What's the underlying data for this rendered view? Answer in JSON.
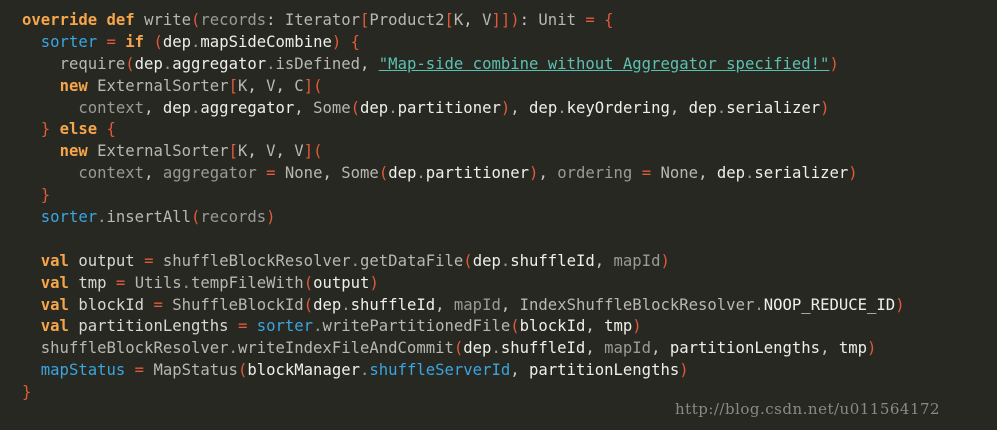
{
  "code_lines": [
    {
      "indent": "",
      "tokens": [
        {
          "k": "kw",
          "t": "override"
        },
        {
          "k": "pl",
          "t": " "
        },
        {
          "k": "kw",
          "t": "def"
        },
        {
          "k": "pl",
          "t": " "
        },
        {
          "k": "fn",
          "t": "write"
        },
        {
          "k": "br",
          "t": "("
        },
        {
          "k": "param",
          "t": "records"
        },
        {
          "k": "pl",
          "t": ": "
        },
        {
          "k": "type",
          "t": "Iterator"
        },
        {
          "k": "br",
          "t": "["
        },
        {
          "k": "type",
          "t": "Product2"
        },
        {
          "k": "br",
          "t": "["
        },
        {
          "k": "tp",
          "t": "K"
        },
        {
          "k": "pl",
          "t": ", "
        },
        {
          "k": "tp",
          "t": "V"
        },
        {
          "k": "br",
          "t": "]]"
        },
        {
          "k": "br",
          "t": ")"
        },
        {
          "k": "pl",
          "t": ": "
        },
        {
          "k": "type",
          "t": "Unit"
        },
        {
          "k": "pl",
          "t": " "
        },
        {
          "k": "op",
          "t": "="
        },
        {
          "k": "pl",
          "t": " "
        },
        {
          "k": "br",
          "t": "{"
        }
      ]
    },
    {
      "indent": "  ",
      "tokens": [
        {
          "k": "var",
          "t": "sorter"
        },
        {
          "k": "pl",
          "t": " "
        },
        {
          "k": "op",
          "t": "="
        },
        {
          "k": "pl",
          "t": " "
        },
        {
          "k": "kw",
          "t": "if"
        },
        {
          "k": "pl",
          "t": " "
        },
        {
          "k": "br",
          "t": "("
        },
        {
          "k": "id",
          "t": "dep"
        },
        {
          "k": "dot",
          "t": "."
        },
        {
          "k": "mem",
          "t": "mapSideCombine"
        },
        {
          "k": "br",
          "t": ")"
        },
        {
          "k": "pl",
          "t": " "
        },
        {
          "k": "br",
          "t": "{"
        }
      ]
    },
    {
      "indent": "    ",
      "tokens": [
        {
          "k": "fn",
          "t": "require"
        },
        {
          "k": "br",
          "t": "("
        },
        {
          "k": "id",
          "t": "dep"
        },
        {
          "k": "dot",
          "t": "."
        },
        {
          "k": "mem",
          "t": "aggregator"
        },
        {
          "k": "dot",
          "t": "."
        },
        {
          "k": "fn",
          "t": "isDefined"
        },
        {
          "k": "pl",
          "t": ", "
        },
        {
          "k": "str",
          "t": "\"Map-side combine without Aggregator specified!\""
        },
        {
          "k": "br",
          "t": ")"
        }
      ]
    },
    {
      "indent": "    ",
      "tokens": [
        {
          "k": "kw",
          "t": "new"
        },
        {
          "k": "pl",
          "t": " "
        },
        {
          "k": "type",
          "t": "ExternalSorter"
        },
        {
          "k": "br",
          "t": "["
        },
        {
          "k": "tp",
          "t": "K"
        },
        {
          "k": "pl",
          "t": ", "
        },
        {
          "k": "tp",
          "t": "V"
        },
        {
          "k": "pl",
          "t": ", "
        },
        {
          "k": "tp",
          "t": "C"
        },
        {
          "k": "br",
          "t": "]("
        }
      ]
    },
    {
      "indent": "      ",
      "tokens": [
        {
          "k": "param",
          "t": "context"
        },
        {
          "k": "pl",
          "t": ", "
        },
        {
          "k": "id",
          "t": "dep"
        },
        {
          "k": "dot",
          "t": "."
        },
        {
          "k": "mem",
          "t": "aggregator"
        },
        {
          "k": "pl",
          "t": ", "
        },
        {
          "k": "type",
          "t": "Some"
        },
        {
          "k": "br",
          "t": "("
        },
        {
          "k": "id",
          "t": "dep"
        },
        {
          "k": "dot",
          "t": "."
        },
        {
          "k": "mem",
          "t": "partitioner"
        },
        {
          "k": "br",
          "t": ")"
        },
        {
          "k": "pl",
          "t": ", "
        },
        {
          "k": "id",
          "t": "dep"
        },
        {
          "k": "dot",
          "t": "."
        },
        {
          "k": "mem",
          "t": "keyOrdering"
        },
        {
          "k": "pl",
          "t": ", "
        },
        {
          "k": "id",
          "t": "dep"
        },
        {
          "k": "dot",
          "t": "."
        },
        {
          "k": "mem",
          "t": "serializer"
        },
        {
          "k": "br",
          "t": ")"
        }
      ]
    },
    {
      "indent": "  ",
      "tokens": [
        {
          "k": "br",
          "t": "}"
        },
        {
          "k": "pl",
          "t": " "
        },
        {
          "k": "kw",
          "t": "else"
        },
        {
          "k": "pl",
          "t": " "
        },
        {
          "k": "br",
          "t": "{"
        }
      ]
    },
    {
      "indent": "    ",
      "tokens": [
        {
          "k": "kw",
          "t": "new"
        },
        {
          "k": "pl",
          "t": " "
        },
        {
          "k": "type",
          "t": "ExternalSorter"
        },
        {
          "k": "br",
          "t": "["
        },
        {
          "k": "tp",
          "t": "K"
        },
        {
          "k": "pl",
          "t": ", "
        },
        {
          "k": "tp",
          "t": "V"
        },
        {
          "k": "pl",
          "t": ", "
        },
        {
          "k": "tp",
          "t": "V"
        },
        {
          "k": "br",
          "t": "]("
        }
      ]
    },
    {
      "indent": "      ",
      "tokens": [
        {
          "k": "param",
          "t": "context"
        },
        {
          "k": "pl",
          "t": ", "
        },
        {
          "k": "param",
          "t": "aggregator"
        },
        {
          "k": "pl",
          "t": " "
        },
        {
          "k": "op",
          "t": "="
        },
        {
          "k": "pl",
          "t": " "
        },
        {
          "k": "type",
          "t": "None"
        },
        {
          "k": "pl",
          "t": ", "
        },
        {
          "k": "type",
          "t": "Some"
        },
        {
          "k": "br",
          "t": "("
        },
        {
          "k": "id",
          "t": "dep"
        },
        {
          "k": "dot",
          "t": "."
        },
        {
          "k": "mem",
          "t": "partitioner"
        },
        {
          "k": "br",
          "t": ")"
        },
        {
          "k": "pl",
          "t": ", "
        },
        {
          "k": "param",
          "t": "ordering"
        },
        {
          "k": "pl",
          "t": " "
        },
        {
          "k": "op",
          "t": "="
        },
        {
          "k": "pl",
          "t": " "
        },
        {
          "k": "type",
          "t": "None"
        },
        {
          "k": "pl",
          "t": ", "
        },
        {
          "k": "id",
          "t": "dep"
        },
        {
          "k": "dot",
          "t": "."
        },
        {
          "k": "mem",
          "t": "serializer"
        },
        {
          "k": "br",
          "t": ")"
        }
      ]
    },
    {
      "indent": "  ",
      "tokens": [
        {
          "k": "br",
          "t": "}"
        }
      ]
    },
    {
      "indent": "  ",
      "tokens": [
        {
          "k": "var",
          "t": "sorter"
        },
        {
          "k": "dot",
          "t": "."
        },
        {
          "k": "fn",
          "t": "insertAll"
        },
        {
          "k": "br",
          "t": "("
        },
        {
          "k": "param",
          "t": "records"
        },
        {
          "k": "br",
          "t": ")"
        }
      ]
    },
    {
      "indent": "",
      "tokens": []
    },
    {
      "indent": "  ",
      "tokens": [
        {
          "k": "kw",
          "t": "val"
        },
        {
          "k": "pl",
          "t": " "
        },
        {
          "k": "def",
          "t": "output"
        },
        {
          "k": "pl",
          "t": " "
        },
        {
          "k": "op",
          "t": "="
        },
        {
          "k": "pl",
          "t": " "
        },
        {
          "k": "fn",
          "t": "shuffleBlockResolver"
        },
        {
          "k": "dot",
          "t": "."
        },
        {
          "k": "fn",
          "t": "getDataFile"
        },
        {
          "k": "br",
          "t": "("
        },
        {
          "k": "id",
          "t": "dep"
        },
        {
          "k": "dot",
          "t": "."
        },
        {
          "k": "mem",
          "t": "shuffleId"
        },
        {
          "k": "pl",
          "t": ", "
        },
        {
          "k": "param",
          "t": "mapId"
        },
        {
          "k": "br",
          "t": ")"
        }
      ]
    },
    {
      "indent": "  ",
      "tokens": [
        {
          "k": "kw",
          "t": "val"
        },
        {
          "k": "pl",
          "t": " "
        },
        {
          "k": "def",
          "t": "tmp"
        },
        {
          "k": "pl",
          "t": " "
        },
        {
          "k": "op",
          "t": "="
        },
        {
          "k": "pl",
          "t": " "
        },
        {
          "k": "type",
          "t": "Utils"
        },
        {
          "k": "dot",
          "t": "."
        },
        {
          "k": "fn",
          "t": "tempFileWith"
        },
        {
          "k": "br",
          "t": "("
        },
        {
          "k": "id",
          "t": "output"
        },
        {
          "k": "br",
          "t": ")"
        }
      ]
    },
    {
      "indent": "  ",
      "tokens": [
        {
          "k": "kw",
          "t": "val"
        },
        {
          "k": "pl",
          "t": " "
        },
        {
          "k": "def",
          "t": "blockId"
        },
        {
          "k": "pl",
          "t": " "
        },
        {
          "k": "op",
          "t": "="
        },
        {
          "k": "pl",
          "t": " "
        },
        {
          "k": "type",
          "t": "ShuffleBlockId"
        },
        {
          "k": "br",
          "t": "("
        },
        {
          "k": "id",
          "t": "dep"
        },
        {
          "k": "dot",
          "t": "."
        },
        {
          "k": "mem",
          "t": "shuffleId"
        },
        {
          "k": "pl",
          "t": ", "
        },
        {
          "k": "param",
          "t": "mapId"
        },
        {
          "k": "pl",
          "t": ", "
        },
        {
          "k": "type",
          "t": "IndexShuffleBlockResolver"
        },
        {
          "k": "dot",
          "t": "."
        },
        {
          "k": "mem",
          "t": "NOOP_REDUCE_ID"
        },
        {
          "k": "br",
          "t": ")"
        }
      ]
    },
    {
      "indent": "  ",
      "tokens": [
        {
          "k": "kw",
          "t": "val"
        },
        {
          "k": "pl",
          "t": " "
        },
        {
          "k": "def",
          "t": "partitionLengths"
        },
        {
          "k": "pl",
          "t": " "
        },
        {
          "k": "op",
          "t": "="
        },
        {
          "k": "pl",
          "t": " "
        },
        {
          "k": "var",
          "t": "sorter"
        },
        {
          "k": "dot",
          "t": "."
        },
        {
          "k": "fn",
          "t": "writePartitionedFile"
        },
        {
          "k": "br",
          "t": "("
        },
        {
          "k": "id",
          "t": "blockId"
        },
        {
          "k": "pl",
          "t": ", "
        },
        {
          "k": "id",
          "t": "tmp"
        },
        {
          "k": "br",
          "t": ")"
        }
      ]
    },
    {
      "indent": "  ",
      "tokens": [
        {
          "k": "fn",
          "t": "shuffleBlockResolver"
        },
        {
          "k": "dot",
          "t": "."
        },
        {
          "k": "fn",
          "t": "writeIndexFileAndCommit"
        },
        {
          "k": "br",
          "t": "("
        },
        {
          "k": "id",
          "t": "dep"
        },
        {
          "k": "dot",
          "t": "."
        },
        {
          "k": "mem",
          "t": "shuffleId"
        },
        {
          "k": "pl",
          "t": ", "
        },
        {
          "k": "param",
          "t": "mapId"
        },
        {
          "k": "pl",
          "t": ", "
        },
        {
          "k": "id",
          "t": "partitionLengths"
        },
        {
          "k": "pl",
          "t": ", "
        },
        {
          "k": "id",
          "t": "tmp"
        },
        {
          "k": "br",
          "t": ")"
        }
      ]
    },
    {
      "indent": "  ",
      "tokens": [
        {
          "k": "var",
          "t": "mapStatus"
        },
        {
          "k": "pl",
          "t": " "
        },
        {
          "k": "op",
          "t": "="
        },
        {
          "k": "pl",
          "t": " "
        },
        {
          "k": "type",
          "t": "MapStatus"
        },
        {
          "k": "br",
          "t": "("
        },
        {
          "k": "id",
          "t": "blockManager"
        },
        {
          "k": "dot",
          "t": "."
        },
        {
          "k": "var",
          "t": "shuffleServerId"
        },
        {
          "k": "pl",
          "t": ", "
        },
        {
          "k": "id",
          "t": "partitionLengths"
        },
        {
          "k": "br",
          "t": ")"
        }
      ]
    },
    {
      "indent": "",
      "tokens": [
        {
          "k": "br",
          "t": "}"
        }
      ]
    }
  ],
  "watermark": "http://blog.csdn.net/u011564172"
}
